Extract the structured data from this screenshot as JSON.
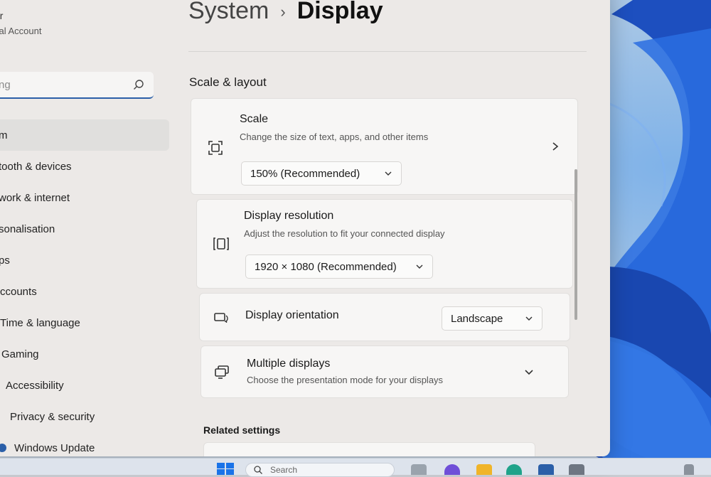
{
  "sidebar": {
    "user_name": "er",
    "user_account": "cal Account",
    "search_placeholder": "ng",
    "items": [
      {
        "label": "m",
        "active": true
      },
      {
        "label": "tooth & devices"
      },
      {
        "label": "work & internet"
      },
      {
        "label": "sonalisation"
      },
      {
        "label": "ps"
      },
      {
        "label": "ccounts"
      },
      {
        "label": "Time & language"
      },
      {
        "label": "Gaming"
      },
      {
        "label": "Accessibility"
      },
      {
        "label": "Privacy & security"
      },
      {
        "label": "Windows Update"
      }
    ]
  },
  "header": {
    "parent": "System",
    "separator": "›",
    "current": "Display"
  },
  "sections": {
    "scale_layout": "Scale & layout",
    "related": "Related settings"
  },
  "cards": {
    "scale": {
      "title": "Scale",
      "subtitle": "Change the size of text, apps, and other items",
      "value": "150% (Recommended)",
      "icon": "scale-icon"
    },
    "resolution": {
      "title": "Display resolution",
      "subtitle": "Adjust the resolution to fit your connected display",
      "value": "1920 × 1080 (Recommended)",
      "icon": "resolution-icon"
    },
    "orientation": {
      "title": "Display orientation",
      "value": "Landscape",
      "icon": "orientation-icon"
    },
    "multiple": {
      "title": "Multiple displays",
      "subtitle": "Choose the presentation mode for your displays",
      "icon": "multiple-displays-icon"
    }
  },
  "taskbar": {
    "search_text": "Search"
  },
  "colors": {
    "accent": "#2b5fa8",
    "window_bg": "#ece9e7",
    "card_bg": "#f7f6f5",
    "wallpaper_blue": "#1f5fd8"
  }
}
